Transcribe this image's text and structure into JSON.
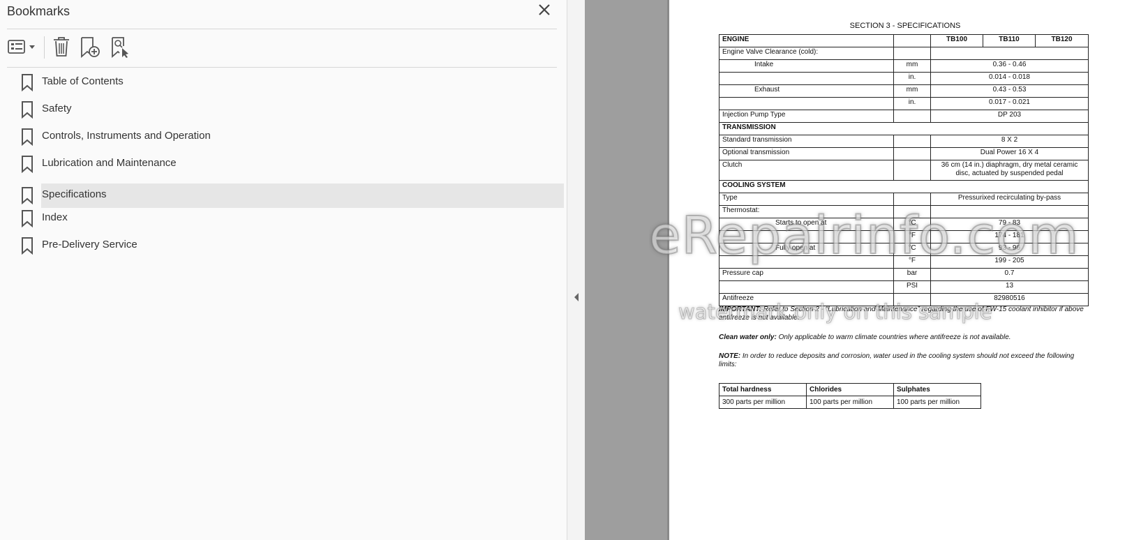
{
  "bookmarks_panel": {
    "title": "Bookmarks",
    "toolbar": {
      "options_icon": "list-options-icon",
      "delete_icon": "trash-icon",
      "add_icon": "add-bookmark-icon",
      "find_icon": "find-current-bookmark-icon"
    },
    "items": [
      {
        "label": "Table of Contents",
        "selected": false
      },
      {
        "label": "Safety",
        "selected": false
      },
      {
        "label": "Controls, Instruments and Operation",
        "selected": false
      },
      {
        "label": "Lubrication and Maintenance",
        "selected": false
      },
      {
        "label": "Specifications",
        "selected": true
      },
      {
        "label": "Index",
        "selected": false
      },
      {
        "label": "Pre-Delivery Service",
        "selected": false
      }
    ]
  },
  "document": {
    "section_title": "SECTION 3 - SPECIFICATIONS",
    "spec_header": {
      "col1": "ENGINE",
      "m1": "TB100",
      "m2": "TB110",
      "m3": "TB120"
    },
    "rows": {
      "valve_clearance": "Engine Valve Clearance (cold):",
      "intake": "Intake",
      "intake_mm_unit": "mm",
      "intake_mm": "0.36 - 0.46",
      "intake_in_unit": "in.",
      "intake_in": "0.014 - 0.018",
      "exhaust": "Exhaust",
      "exhaust_mm_unit": "mm",
      "exhaust_mm": "0.43 - 0.53",
      "exhaust_in_unit": "in.",
      "exhaust_in": "0.017 - 0.021",
      "injection_pump": "Injection Pump Type",
      "injection_pump_val": "DP 203",
      "transmission": "TRANSMISSION",
      "std_trans": "Standard transmission",
      "std_trans_val": "8 X 2",
      "opt_trans": "Optional transmission",
      "opt_trans_val": "Dual Power 16 X 4",
      "clutch": "Clutch",
      "clutch_val": "36 cm (14 in.) diaphragm, dry metal ceramic disc, actuated by suspended pedal",
      "cooling": "COOLING SYSTEM",
      "type": "Type",
      "type_val": "Pressurixed recirculating by-pass",
      "thermostat": "Thermostat:",
      "starts_open": "Starts to open at",
      "starts_c_unit": "°C",
      "starts_c": "79 - 83",
      "starts_f_unit": "°F",
      "starts_f": "174 - 181",
      "fully_open": "Fully open at",
      "fully_c_unit": "°C",
      "fully_c": "93 - 96",
      "fully_f_unit": "°F",
      "fully_f": "199 - 205",
      "pressure_cap": "Pressure cap",
      "pc_bar_unit": "bar",
      "pc_bar": "0.7",
      "pc_psi_unit": "PSI",
      "pc_psi": "13",
      "antifreeze": "Antifreeze",
      "antifreeze_val": "82980516"
    },
    "notes": {
      "important_label": "IMPORTANT:",
      "important_text": "Refer to Section 2 - “Lubrication and Maintenance” regarding the use of FW-15 coolant inhibitor if above antifreeze is not available.",
      "clean_label": "Clean water only:",
      "clean_text": "Only applicable to warm climate countries where antifreeze is not available.",
      "note_label": "NOTE:",
      "note_text": "In order to reduce deposits and corrosion, water used in the cooling system should not exceed the following limits:"
    },
    "water_table": {
      "headers": [
        "Total hardness",
        "Chlorides",
        "Sulphates"
      ],
      "values": [
        "300 parts per million",
        "100 parts per million",
        "100 parts per million"
      ]
    },
    "watermark": {
      "main": "eRepairinfo.com",
      "sub": "watermark only on this sample"
    }
  }
}
